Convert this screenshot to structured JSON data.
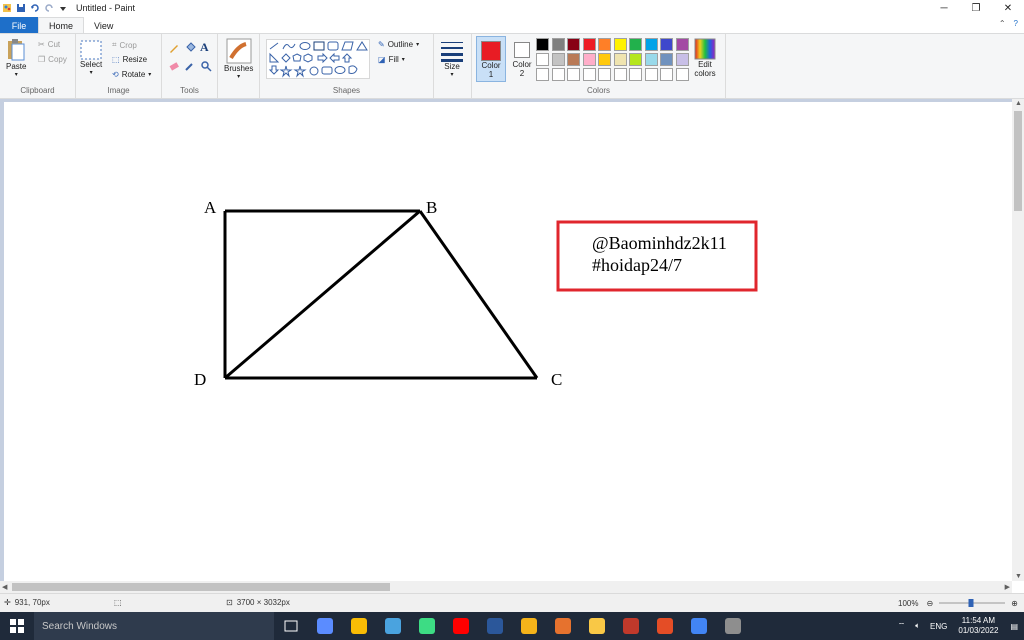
{
  "window": {
    "title": "Untitled - Paint",
    "minimize_glyph": "─",
    "restore_glyph": "❐",
    "close_glyph": "✕"
  },
  "menu": {
    "file": "File",
    "home": "Home",
    "view": "View"
  },
  "ribbon": {
    "clipboard": {
      "label": "Clipboard",
      "paste": "Paste",
      "cut": "Cut",
      "copy": "Copy"
    },
    "image": {
      "label": "Image",
      "select": "Select",
      "crop": "Crop",
      "resize": "Resize",
      "rotate": "Rotate"
    },
    "tools": {
      "label": "Tools"
    },
    "brushes": {
      "label": "Brushes"
    },
    "shapes": {
      "label": "Shapes",
      "outline": "Outline",
      "fill": "Fill"
    },
    "size": {
      "label": "Size"
    },
    "colors": {
      "label": "Colors",
      "color1": "Color\n1",
      "color2": "Color\n2",
      "edit": "Edit\ncolors",
      "color1_value": "#e81c24",
      "color2_value": "#ffffff",
      "row1": [
        "#000000",
        "#7f7f7f",
        "#880015",
        "#ed1c24",
        "#ff7f27",
        "#fff200",
        "#22b14c",
        "#00a2e8",
        "#3f48cc",
        "#a349a4"
      ],
      "row2": [
        "#ffffff",
        "#c3c3c3",
        "#b97a57",
        "#ffaec9",
        "#ffc90e",
        "#efe4b0",
        "#b5e61d",
        "#99d9ea",
        "#7092be",
        "#c8bfe7"
      ],
      "row3": [
        "#ffffff",
        "#ffffff",
        "#ffffff",
        "#ffffff",
        "#ffffff",
        "#ffffff",
        "#ffffff",
        "#ffffff",
        "#ffffff",
        "#ffffff"
      ]
    }
  },
  "drawing": {
    "vertex_a": "A",
    "vertex_b": "B",
    "vertex_c": "C",
    "vertex_d": "D",
    "note_line1": "@Baominhdz2k11",
    "note_line2": "#hoidap24/7",
    "note_border_color": "#e0262d"
  },
  "statusbar": {
    "cursor_pos": "931, 70px",
    "canvas_size": "3700 × 3032px",
    "zoom": "100%"
  },
  "taskbar": {
    "search_placeholder": "Search Windows",
    "language": "ENG",
    "time": "11:54 AM",
    "date": "01/03/2022",
    "apps": [
      "#5b8cff",
      "#f9bc05",
      "#4aa3df",
      "#3ddc84",
      "#ff0000",
      "#2b579a",
      "#f5b31a",
      "#e6722e",
      "#f9c846",
      "#c0392b",
      "#e44d26",
      "#4285f4",
      "#8e8e8e"
    ]
  }
}
